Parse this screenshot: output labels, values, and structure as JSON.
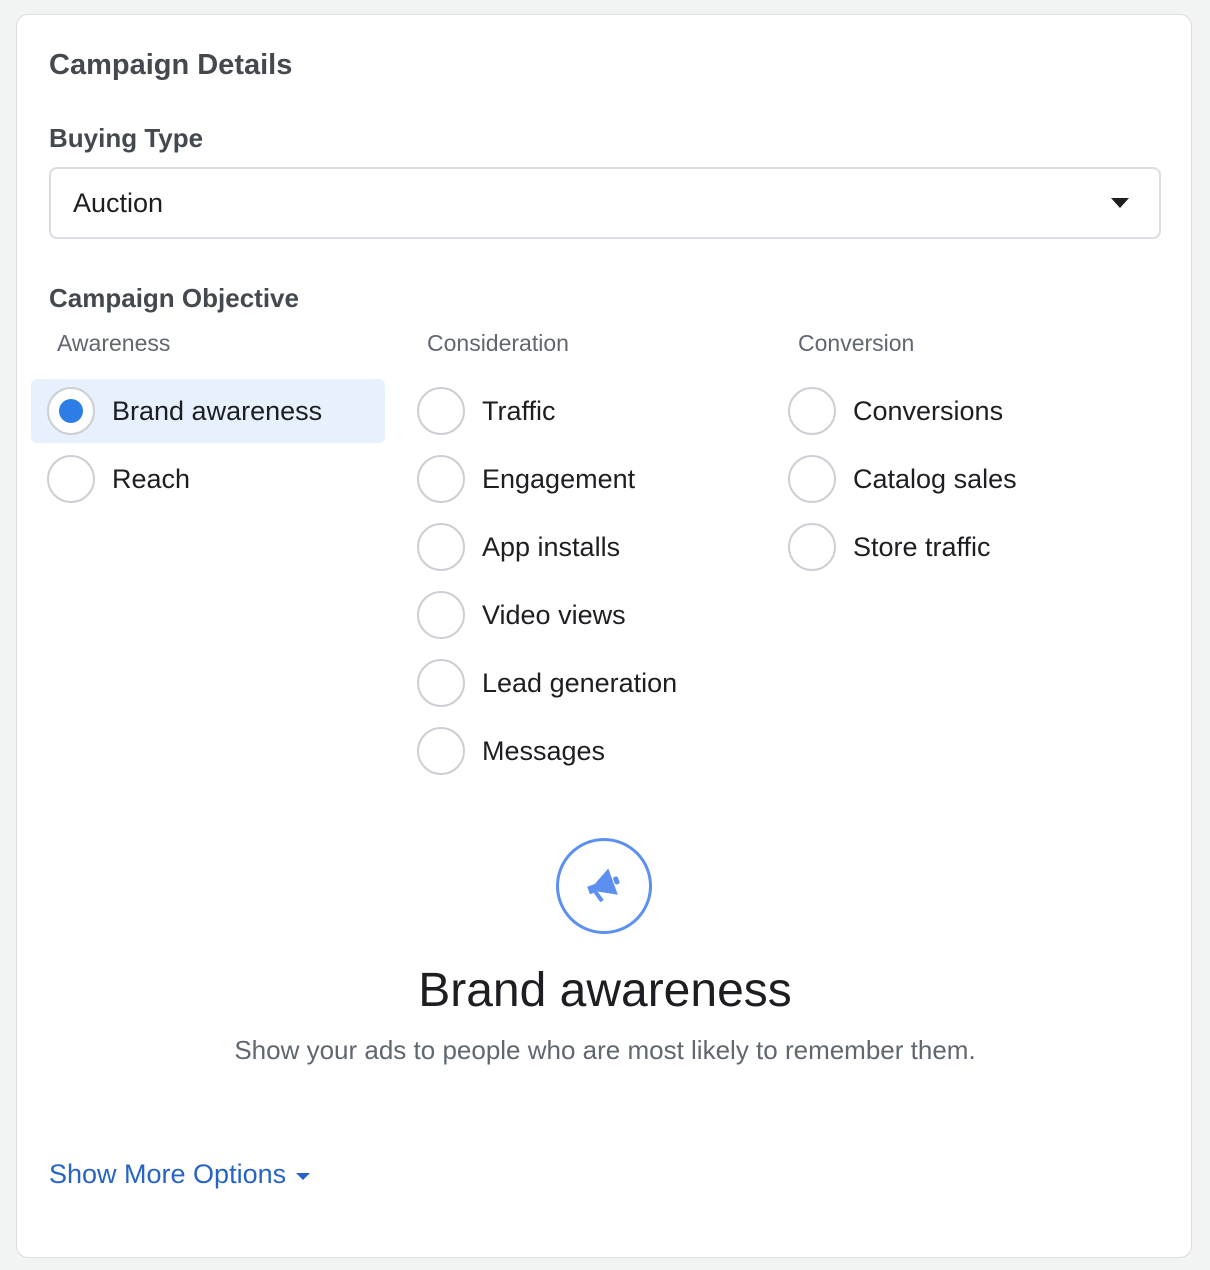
{
  "card": {
    "title": "Campaign Details"
  },
  "buying_type": {
    "label": "Buying Type",
    "value": "Auction",
    "icon": "caret-down-icon"
  },
  "objective": {
    "label": "Campaign Objective",
    "selected": "Brand awareness",
    "columns": [
      {
        "header": "Awareness",
        "options": [
          "Brand awareness",
          "Reach"
        ]
      },
      {
        "header": "Consideration",
        "options": [
          "Traffic",
          "Engagement",
          "App installs",
          "Video views",
          "Lead generation",
          "Messages"
        ]
      },
      {
        "header": "Conversion",
        "options": [
          "Conversions",
          "Catalog sales",
          "Store traffic"
        ]
      }
    ]
  },
  "detail": {
    "icon": "megaphone-icon",
    "title": "Brand awareness",
    "description": "Show your ads to people who are most likely to remember them."
  },
  "show_more": {
    "label": "Show More Options"
  },
  "colors": {
    "accent": "#2d7de7",
    "selected_bg": "#e7f0fd",
    "link": "#2664c7",
    "icon_ring": "#5b8ff0"
  }
}
